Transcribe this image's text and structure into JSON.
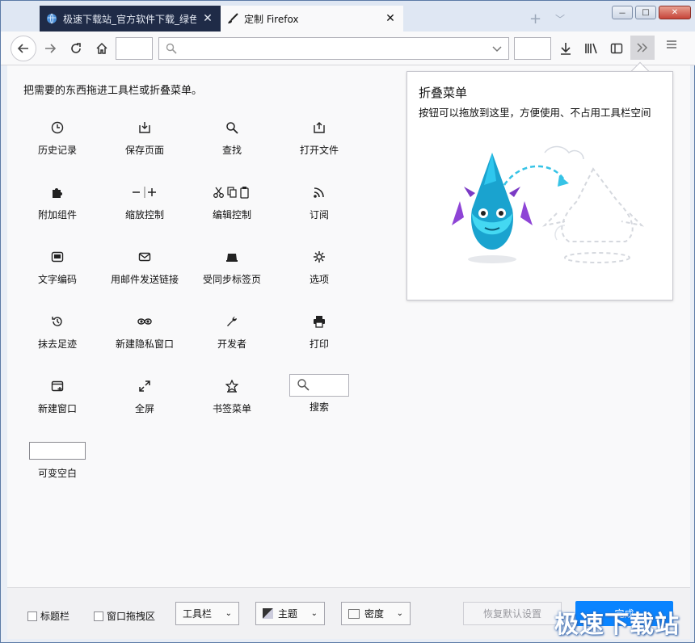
{
  "tabs": [
    {
      "label": "极速下载站_官方软件下载_绿色"
    },
    {
      "label": "定制 Firefox"
    }
  ],
  "window": {
    "minimize": "－",
    "maximize": "□",
    "close": "✕"
  },
  "instruction": "把需要的东西拖进工具栏或折叠菜单。",
  "items": [
    {
      "label": "历史记录",
      "icon": "history-icon"
    },
    {
      "label": "保存页面",
      "icon": "save-page-icon"
    },
    {
      "label": "查找",
      "icon": "find-icon"
    },
    {
      "label": "打开文件",
      "icon": "open-file-icon"
    },
    {
      "label": "附加组件",
      "icon": "addons-icon"
    },
    {
      "label": "缩放控制",
      "icon": "zoom-icon"
    },
    {
      "label": "编辑控制",
      "icon": "edit-icon"
    },
    {
      "label": "订阅",
      "icon": "rss-icon"
    },
    {
      "label": "文字编码",
      "icon": "encoding-icon"
    },
    {
      "label": "用邮件发送链接",
      "icon": "email-icon"
    },
    {
      "label": "受同步标签页",
      "icon": "synced-tabs-icon"
    },
    {
      "label": "选项",
      "icon": "options-icon"
    },
    {
      "label": "抹去足迹",
      "icon": "forget-icon"
    },
    {
      "label": "新建隐私窗口",
      "icon": "private-window-icon"
    },
    {
      "label": "开发者",
      "icon": "developer-icon"
    },
    {
      "label": "打印",
      "icon": "print-icon"
    },
    {
      "label": "新建窗口",
      "icon": "new-window-icon"
    },
    {
      "label": "全屏",
      "icon": "fullscreen-icon"
    },
    {
      "label": "书签菜单",
      "icon": "bookmarks-menu-icon"
    },
    {
      "label": "搜索",
      "icon": "search-icon"
    },
    {
      "label": "可变空白",
      "icon": "flexible-space"
    }
  ],
  "panel": {
    "title": "折叠菜单",
    "description": "按钮可以拖放到这里，方便使用、不占用工具栏空间"
  },
  "bottom": {
    "titlebar": "标题栏",
    "dragspace": "窗口拖拽区",
    "toolbars": "工具栏",
    "themes": "主题",
    "density": "密度",
    "restore": "恢复默认设置",
    "done": "完成"
  },
  "watermark": "极速下载站"
}
